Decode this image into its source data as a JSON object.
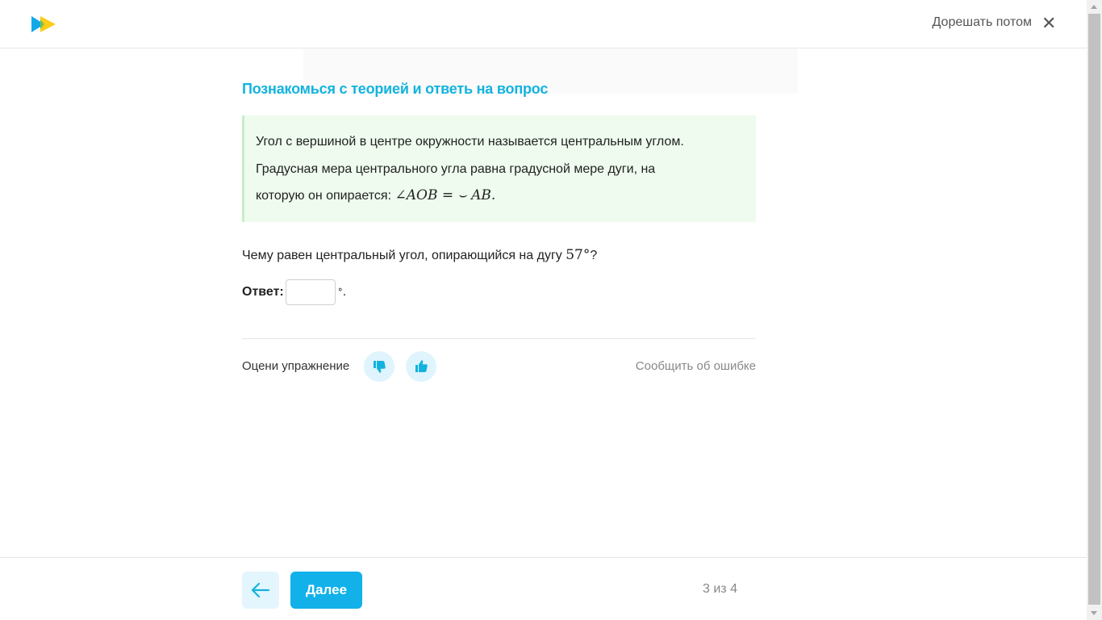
{
  "header": {
    "logo_icon": "play-logo-icon",
    "later_label": "Дорешать потом",
    "close_icon": "close-icon",
    "close_glyph": "✕"
  },
  "main": {
    "title": "Познакомься с теорией и ответь на вопрос",
    "theory": {
      "line1": "Угол с вершиной в центре окружности называется центральным углом.",
      "line2": "Градусная мера центрального угла равна градусной мере дуги, на",
      "line3_text": "которую он опирается: ",
      "formula": "∠AOB = ⌣ AB."
    },
    "question": {
      "text": "Чему равен центральный угол, опирающийся на дугу ",
      "value": "57°",
      "end": "?"
    },
    "answer": {
      "label": "Ответ:",
      "value": "",
      "unit": "°",
      "end": "."
    },
    "rating": {
      "label": "Оцени упражнение",
      "dislike_icon": "thumbs-down-icon",
      "like_icon": "thumbs-up-icon"
    },
    "report_label": "Сообщить об ошибке"
  },
  "footer": {
    "back_icon": "arrow-left-icon",
    "next_label": "Далее",
    "progress": "3 из 4"
  },
  "colors": {
    "accent": "#13b3de",
    "button": "#12b1ea",
    "theory_bg": "#eefbee",
    "rate_bg": "#dff4fc"
  }
}
